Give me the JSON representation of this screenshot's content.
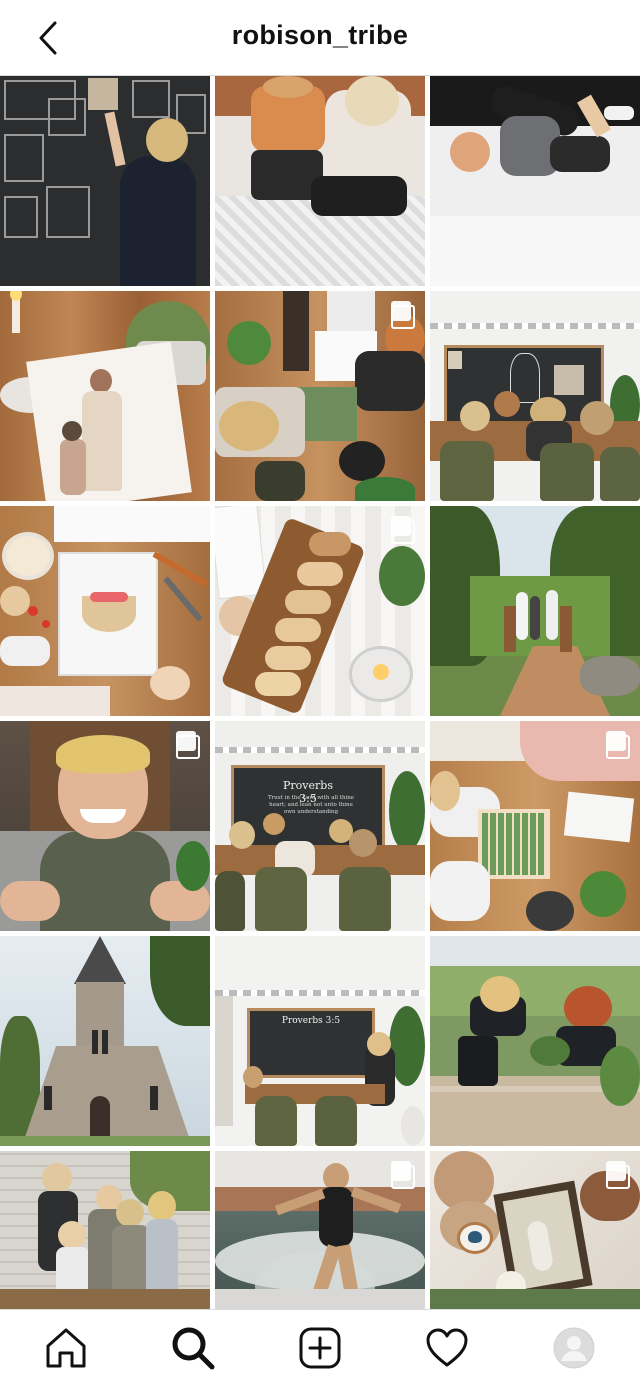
{
  "header": {
    "username": "robison_tribe"
  },
  "grid": {
    "posts": [
      {
        "subject": "boy-at-chalkboard",
        "multi": false
      },
      {
        "subject": "mother-and-son-on-rug",
        "multi": false
      },
      {
        "subject": "wrestling-match",
        "multi": false
      },
      {
        "subject": "jesus-watercolor-painting",
        "multi": false
      },
      {
        "subject": "kids-painting-at-table",
        "multi": true
      },
      {
        "subject": "homeschool-classroom",
        "multi": false
      },
      {
        "subject": "easter-basket-drawing",
        "multi": false
      },
      {
        "subject": "pastries-on-board",
        "multi": true
      },
      {
        "subject": "family-on-garden-bridge",
        "multi": false
      },
      {
        "subject": "smiling-boy-portrait",
        "multi": true
      },
      {
        "subject": "proverbs-chalkboard-lesson",
        "multi": false
      },
      {
        "subject": "kids-with-letter-board",
        "multi": true
      },
      {
        "subject": "stone-church",
        "multi": false
      },
      {
        "subject": "classroom-wide-view",
        "multi": false
      },
      {
        "subject": "girls-gardening",
        "multi": false
      },
      {
        "subject": "four-kids-portrait",
        "multi": false
      },
      {
        "subject": "wakesurfing-woman",
        "multi": true
      },
      {
        "subject": "hands-with-framed-picture",
        "multi": true
      }
    ]
  },
  "chalkboard_text": {
    "title": "Proverbs 3:5",
    "verse": "Trust in the Lord with all thine heart; and lean not unto thine own understanding"
  },
  "bottom_nav": {
    "items": [
      "home-icon",
      "search-icon",
      "new-post-icon",
      "activity-icon",
      "profile-avatar"
    ],
    "active": "search-icon"
  }
}
